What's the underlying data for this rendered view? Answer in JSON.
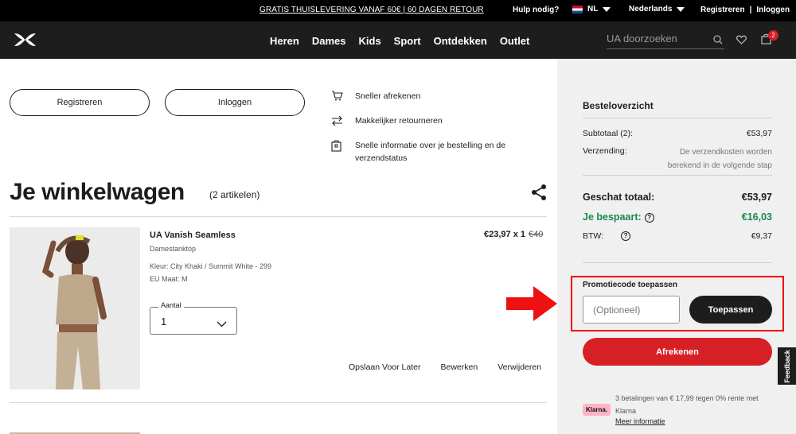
{
  "topbar": {
    "promo": "GRATIS THUISLEVERING VANAF 60€ | 60 DAGEN RETOUR",
    "help": "Hulp nodig?",
    "language": "NL",
    "country": "Nederlands",
    "register": "Registreren",
    "separator": "|",
    "login": "Inloggen"
  },
  "nav": {
    "items": [
      "Heren",
      "Dames",
      "Kids",
      "Sport",
      "Ontdekken",
      "Outlet"
    ],
    "search_placeholder": "UA doorzoeken",
    "cart_count": "2"
  },
  "account_prompt": {
    "register_label": "Registreren",
    "login_label": "Inloggen",
    "benefits": [
      {
        "icon": "cart-icon",
        "text": "Sneller afrekenen"
      },
      {
        "icon": "arrows-exchange-icon",
        "text": "Makkelijker retourneren"
      },
      {
        "icon": "package-icon",
        "text": "Snelle informatie over je bestelling en de verzendstatus"
      }
    ]
  },
  "cart": {
    "title": "Je winkelwagen",
    "count": "(2 artikelen)"
  },
  "item": {
    "name": "UA Vanish Seamless",
    "type": "Damestanktop",
    "color": "Kleur: City Khaki / Summit White - 299",
    "size": "EU Maat: M",
    "quantity_label": "Aantal",
    "quantity_value": "1",
    "price": "€23,97 x 1",
    "original_price": "€40",
    "actions": [
      "Opslaan Voor Later",
      "Bewerken",
      "Verwijderen"
    ]
  },
  "summary": {
    "title": "Besteloverzicht",
    "subtotal_label": "Subtotaal (2):",
    "subtotal_value": "€53,97",
    "shipping_label": "Verzending:",
    "shipping_value": "De verzendkosten worden berekend in de volgende stap",
    "total_label": "Geschat totaal:",
    "total_value": "€53,97",
    "savings_label": "Je bespaart:",
    "savings_value": "€16,03",
    "vat_label": "BTW:",
    "vat_value": "€9,37",
    "promo_label": "Promotiecode toepassen",
    "promo_placeholder": "(Optioneel)",
    "apply_label": "Toepassen",
    "checkout_label": "Afrekenen",
    "klarna_badge": "Klarna.",
    "klarna_text": "3 betalingen van € 17,99 tegen 0% rente met Klarna",
    "klarna_link": "Meer informatie"
  },
  "feedback_label": "Feedback",
  "colors": {
    "accent_red": "#d71f26",
    "savings_green": "#168a4a",
    "nav_black": "#1d1d1d",
    "highlight_red": "#ee0000",
    "klarna_pink": "#ffb3c7"
  }
}
